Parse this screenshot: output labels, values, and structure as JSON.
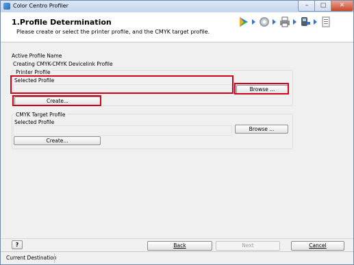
{
  "window": {
    "title": "Color Centro Profiler",
    "controls": {
      "minimize": "–",
      "maximize": "□",
      "close": "✕"
    }
  },
  "header": {
    "title": "1.Profile Determination",
    "subtitle": "Please create or select the printer profile, and the CMYK target profile.",
    "step_icons": [
      "play-icon",
      "gear-icon",
      "printer-icon",
      "measure-device-icon",
      "document-icon"
    ]
  },
  "profile": {
    "active_label": "Active Profile Name",
    "active_value": "Creating CMYK-CMYK Devicelink Profile"
  },
  "printer_profile": {
    "group_label": "Printer Profile",
    "selected_label": "Selected Profile",
    "selected_value": "",
    "browse_label": "Browse ...",
    "create_label": "Create..."
  },
  "cmyk_target_profile": {
    "group_label": "CMYK Target Profile",
    "selected_label": "Selected Profile",
    "selected_value": "",
    "browse_label": "Browse ...",
    "create_label": "Create..."
  },
  "footer": {
    "help_label": "?",
    "back_label": "Back",
    "next_label": "Next",
    "cancel_label": "Cancel"
  },
  "statusbar": {
    "text": "Current Destination"
  },
  "colors": {
    "highlight": "#d0021b",
    "accent": "#3b6fc4"
  }
}
